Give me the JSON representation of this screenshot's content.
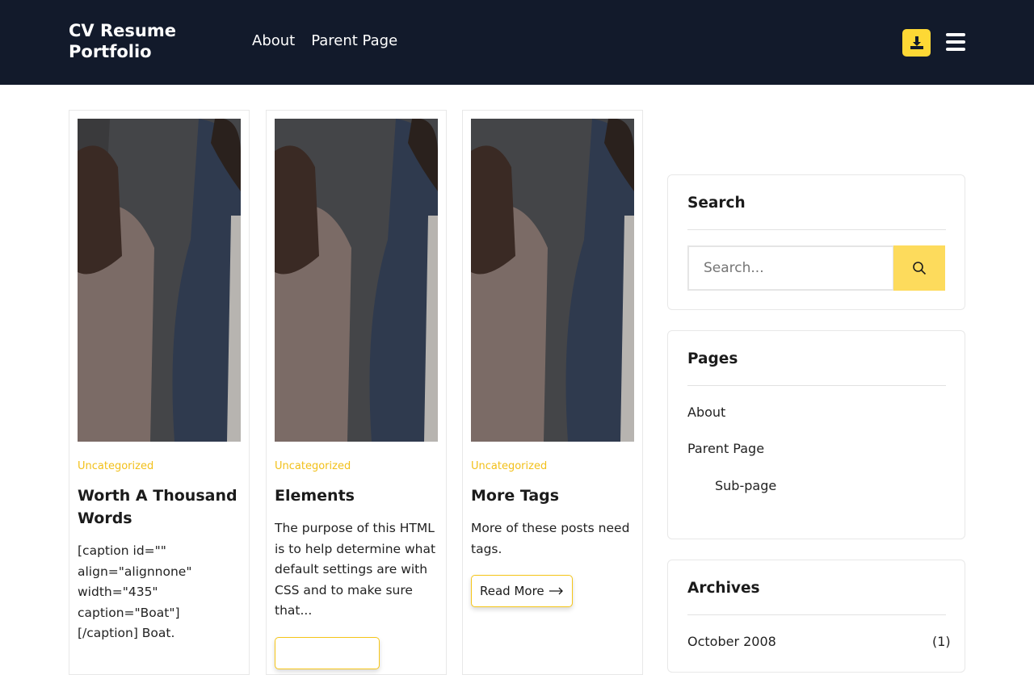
{
  "header": {
    "logo": "CV Resume Portfolio",
    "nav": [
      "About",
      "Parent Page"
    ],
    "download_icon": "download-icon",
    "menu_icon": "hamburger-icon",
    "accent": "#fdd835",
    "background": "#121a2b"
  },
  "posts": [
    {
      "category": "Uncategorized",
      "title": "Worth A Thousand Words",
      "excerpt": "[caption id=\"\" align=\"alignnone\" width=\"435\" caption=\"Boat\"] [/caption] Boat."
    },
    {
      "category": "Uncategorized",
      "title": "Elements",
      "excerpt": "The purpose of this HTML is to help determine what default settings are with CSS and to make sure that..."
    },
    {
      "category": "Uncategorized",
      "title": "More Tags",
      "excerpt": "More of these posts need tags.",
      "read_more": "Read More"
    }
  ],
  "sidebar": {
    "search": {
      "title": "Search",
      "placeholder": "Search..."
    },
    "pages": {
      "title": "Pages",
      "items": [
        "About",
        "Parent Page",
        "Sub-page"
      ]
    },
    "archives": {
      "title": "Archives",
      "items": [
        {
          "label": "October 2008",
          "count": "(1)"
        }
      ]
    }
  }
}
